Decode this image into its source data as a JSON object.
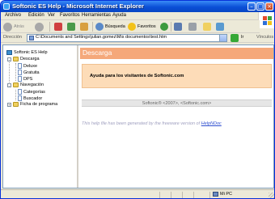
{
  "window": {
    "title": "Softonic ES Help - Microsoft Internet Explorer"
  },
  "menu": [
    "Archivo",
    "Edición",
    "Ver",
    "Favoritos",
    "Herramientas",
    "Ayuda"
  ],
  "toolbar": {
    "back_label": "Atrás",
    "search_label": "Búsqueda",
    "favorites_label": "Favoritos"
  },
  "address": {
    "label": "Dirección",
    "url": "C:\\Documents and Settings\\julian.gomez\\Mis documentos\\test.htm",
    "go_label": "Ir",
    "links_label": "Vínculos"
  },
  "tree": {
    "root": "Softonic ES Help",
    "descarga": "Descarga",
    "deluxe": "Deluxe",
    "gratuita": "Gratuita",
    "dps": "DPS",
    "navegacion": "Navegación",
    "categorias": "Categorías",
    "buscador": "Buscador",
    "ficha": "Ficha de programa"
  },
  "doc": {
    "header": "Descarga",
    "ayuda": "Ayuda para los visitantes de Softonic.com",
    "footer": "Softonic® <2007>, <Softonic.com>",
    "generated_prefix": "This help file has been generated by the freeware version of ",
    "generated_link": "HelpNDoc"
  },
  "status": {
    "zone": "Mi PC"
  },
  "colors": {
    "header_bg": "#f5a87a",
    "ayuda_bg": "#fddcb8",
    "titlebar": "#0a4fd6"
  }
}
